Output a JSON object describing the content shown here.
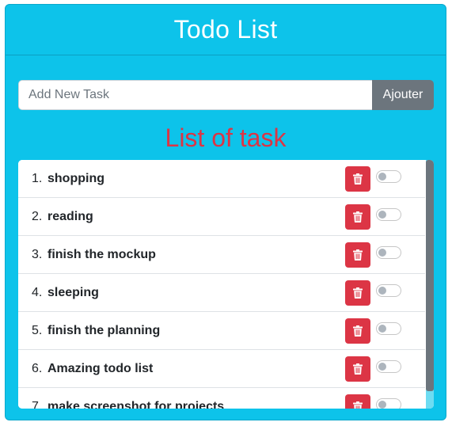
{
  "header": {
    "title": "Todo List"
  },
  "new_task": {
    "placeholder": "Add New Task",
    "value": "",
    "add_label": "Ajouter"
  },
  "list_title": "List of task",
  "tasks": [
    {
      "number": "1.",
      "text": "shopping",
      "done": false
    },
    {
      "number": "2.",
      "text": "reading",
      "done": false
    },
    {
      "number": "3.",
      "text": "finish the mockup",
      "done": false
    },
    {
      "number": "4.",
      "text": "sleeping",
      "done": false
    },
    {
      "number": "5.",
      "text": "finish the planning",
      "done": false
    },
    {
      "number": "6.",
      "text": "Amazing todo list",
      "done": false
    },
    {
      "number": "7.",
      "text": "make screenshot for projects",
      "done": false
    }
  ],
  "icons": {
    "delete": "trash-icon",
    "status": "toggle-switch"
  },
  "colors": {
    "primary": "#0dc3ea",
    "danger": "#dc3545",
    "secondary": "#6c757d",
    "white": "#ffffff"
  }
}
